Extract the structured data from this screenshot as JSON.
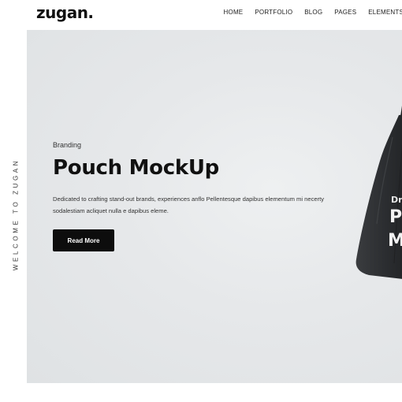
{
  "brand": {
    "logo": "zugan."
  },
  "nav": {
    "items": [
      "HOME",
      "PORTFOLIO",
      "BLOG",
      "PAGES",
      "ELEMENTS"
    ]
  },
  "side": {
    "text": "WELCOME TO ZUGAN"
  },
  "hero": {
    "category": "Branding",
    "title": "Pouch MockUp",
    "description": "Dedicated to crafting stand-out brands, experiences anflo Pellentesque dapibus elementum mi necerty sodalestiam acliquet nulla e dapibus eleme.",
    "button_label": "Read More",
    "image": {
      "icon": "pouch-mockup-image",
      "printed_text": [
        "Dr",
        "P",
        "M"
      ]
    }
  },
  "colors": {
    "hero_bg": "#e6e8ea",
    "button_bg": "#0d0d0d",
    "pouch": "#2e3033",
    "text": "#111111"
  }
}
